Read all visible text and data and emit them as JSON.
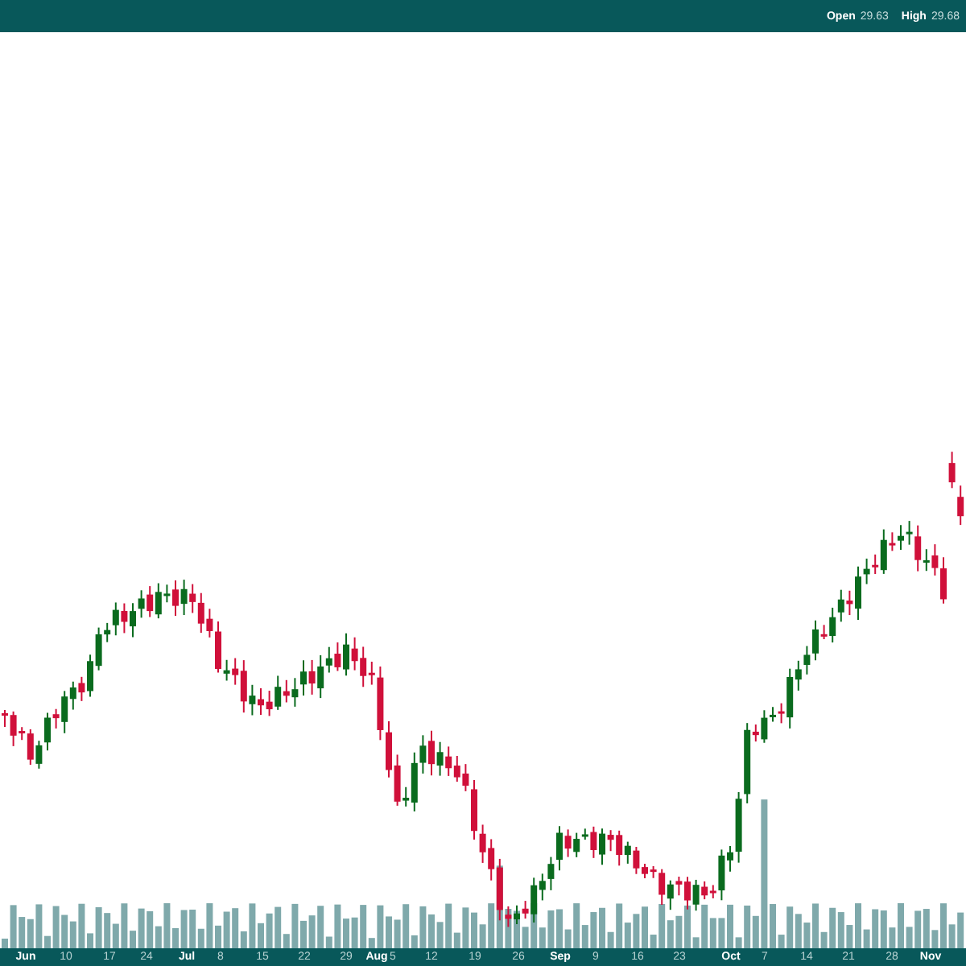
{
  "header": {
    "quotes": [
      {
        "label": "Open",
        "value": "29.63"
      },
      {
        "label": "High",
        "value": "29.68"
      }
    ]
  },
  "x_axis": {
    "labels": [
      {
        "text": "Jun",
        "kind": "month"
      },
      {
        "text": "10",
        "kind": "day"
      },
      {
        "text": "17",
        "kind": "day"
      },
      {
        "text": "24",
        "kind": "day"
      },
      {
        "text": "Jul",
        "kind": "month"
      },
      {
        "text": "8",
        "kind": "day"
      },
      {
        "text": "15",
        "kind": "day"
      },
      {
        "text": "22",
        "kind": "day"
      },
      {
        "text": "29",
        "kind": "day"
      },
      {
        "text": "Aug",
        "kind": "month"
      },
      {
        "text": "5",
        "kind": "day"
      },
      {
        "text": "12",
        "kind": "day"
      },
      {
        "text": "19",
        "kind": "day"
      },
      {
        "text": "26",
        "kind": "day"
      },
      {
        "text": "Sep",
        "kind": "month"
      },
      {
        "text": "9",
        "kind": "day"
      },
      {
        "text": "16",
        "kind": "day"
      },
      {
        "text": "23",
        "kind": "day"
      },
      {
        "text": "Oct",
        "kind": "month"
      },
      {
        "text": "7",
        "kind": "day"
      },
      {
        "text": "14",
        "kind": "day"
      },
      {
        "text": "21",
        "kind": "day"
      },
      {
        "text": "28",
        "kind": "day"
      },
      {
        "text": "Nov",
        "kind": "month"
      }
    ]
  }
}
